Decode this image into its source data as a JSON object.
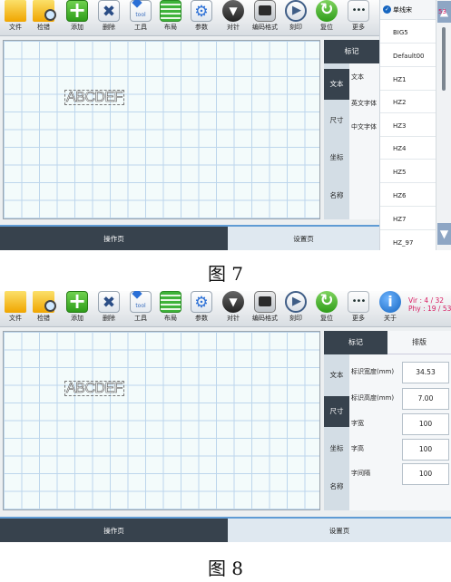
{
  "toolbar": {
    "file": "文件",
    "search": "检错",
    "add": "添加",
    "delete": "删除",
    "tool": "工具",
    "layout": "布局",
    "params": "参数",
    "pin": "对针",
    "code": "编码格式",
    "print": "刻印",
    "reset": "复位",
    "more": "更多",
    "about": "关于"
  },
  "version": {
    "vir": "Vir : 4 / 32",
    "phy": "Phy : 19 / 53",
    "fig1_partial": "53"
  },
  "canvas_text": "ABCDEF",
  "panel": {
    "tab_mark": "标记",
    "tab_layout": "排版",
    "side": [
      "文本",
      "尺寸",
      "坐标",
      "名称"
    ]
  },
  "fig1": {
    "labels": [
      "文本",
      "英文字体",
      "中文字体"
    ],
    "dropdown": {
      "selected": "单线宋",
      "items": [
        "BIG5",
        "Default00",
        "HZ1",
        "HZ2",
        "HZ3",
        "HZ4",
        "HZ5",
        "HZ6",
        "HZ7",
        "HZ_97"
      ]
    }
  },
  "fig2": {
    "fields": [
      {
        "label": "标识宽度(mm)",
        "value": "34.53"
      },
      {
        "label": "标识高度(mm)",
        "value": "7.00"
      },
      {
        "label": "字宽",
        "value": "100"
      },
      {
        "label": "字高",
        "value": "100"
      },
      {
        "label": "字间隔",
        "value": "100"
      }
    ]
  },
  "bottom": {
    "op": "操作页",
    "set": "设置页"
  },
  "captions": {
    "fig7": "图 7",
    "fig8": "图 8"
  },
  "colors": {
    "dark": "#37424d",
    "accent": "#5f9bd4",
    "version": "#d81b60",
    "grid": "#bdd6ec"
  }
}
